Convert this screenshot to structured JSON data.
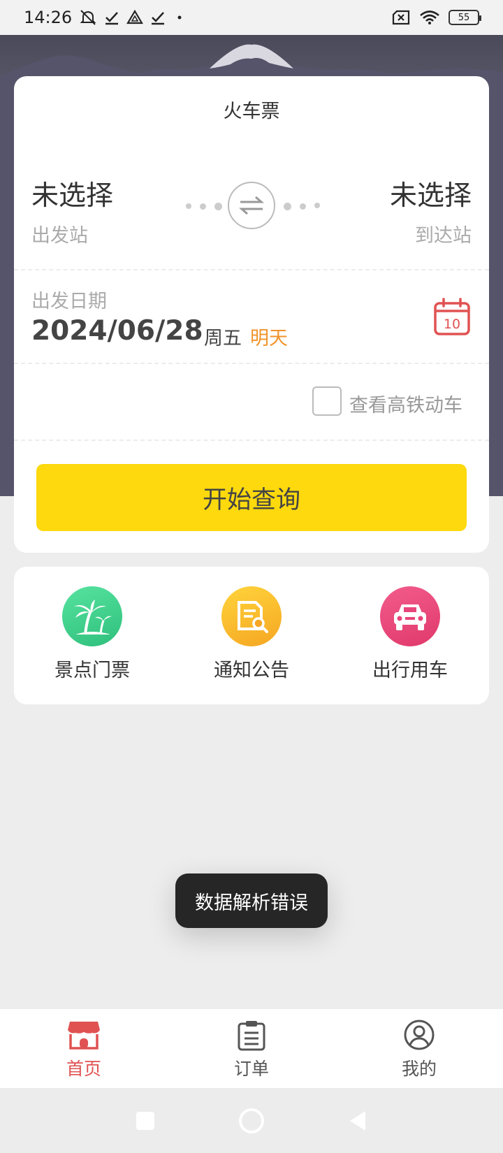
{
  "status_bar": {
    "time": "14:26",
    "left_icons": [
      "mute-icon",
      "check-icon",
      "drive-icon",
      "check-icon",
      "dot-icon"
    ],
    "battery": "55"
  },
  "ticket": {
    "title": "火车票",
    "from_station": "未选择",
    "from_label": "出发站",
    "to_station": "未选择",
    "to_label": "到达站",
    "date_label": "出发日期",
    "date_value": "2024/06/28",
    "weekday": "周五",
    "relative_day": "明天",
    "calendar_day": "10",
    "highspeed_label": "查看高铁动车",
    "highspeed_checked": false,
    "search_button": "开始查询"
  },
  "services": [
    {
      "label": "景点门票",
      "icon": "palm-tree-icon",
      "color": "#3ecf8e"
    },
    {
      "label": "通知公告",
      "icon": "document-search-icon",
      "color": "#f7b500"
    },
    {
      "label": "出行用车",
      "icon": "car-icon",
      "color": "#e8457a"
    }
  ],
  "toast": "数据解析错误",
  "tab_bar": [
    {
      "label": "首页",
      "icon": "shop-icon",
      "active": true
    },
    {
      "label": "订单",
      "icon": "clipboard-icon",
      "active": false
    },
    {
      "label": "我的",
      "icon": "user-icon",
      "active": false
    }
  ],
  "colors": {
    "accent_yellow": "#fdd90d",
    "active_red": "#e05252",
    "relative_day_orange": "#f0932b"
  }
}
